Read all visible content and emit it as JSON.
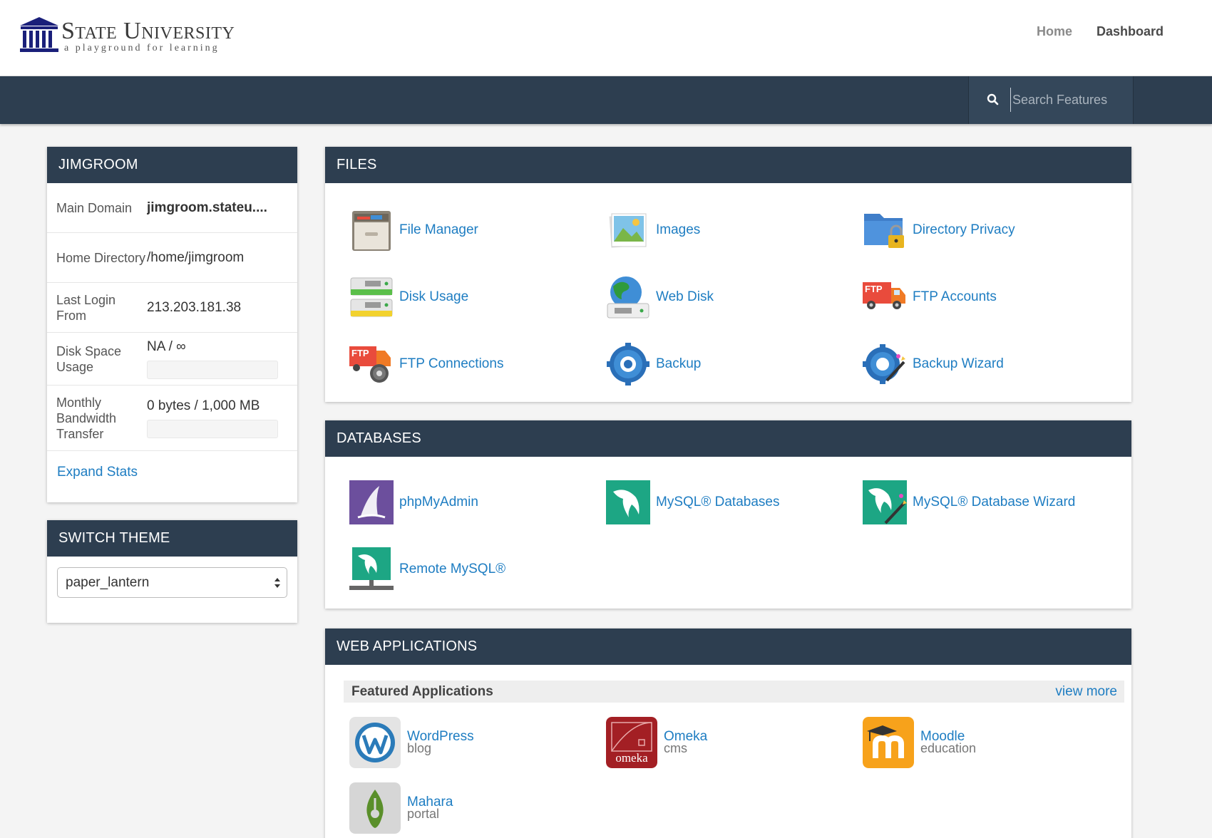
{
  "brand": {
    "title": "State University",
    "tagline": "a playground for learning"
  },
  "topnav": [
    {
      "label": "Home",
      "active": false
    },
    {
      "label": "Dashboard",
      "active": true
    }
  ],
  "search": {
    "placeholder": "Search Features",
    "icon": "search-icon"
  },
  "account": {
    "title": "JIMGROOM",
    "rows": [
      {
        "label": "Main Domain",
        "value": "jimgroom.stateu...."
      },
      {
        "label": "Home Directory",
        "value": "/home/jimgroom"
      },
      {
        "label": "Last Login From",
        "value": "213.203.181.38"
      },
      {
        "label": "Disk Space Usage",
        "value": "NA / ∞",
        "meter": 0
      },
      {
        "label": "Monthly Bandwidth Transfer",
        "value": "0 bytes / 1,000 MB",
        "meter": 0
      }
    ],
    "expand_label": "Expand Stats"
  },
  "theme": {
    "title": "SWITCH THEME",
    "selected": "paper_lantern"
  },
  "files": {
    "title": "FILES",
    "items": [
      {
        "label": "File Manager",
        "icon": "file-manager-icon"
      },
      {
        "label": "Images",
        "icon": "images-icon"
      },
      {
        "label": "Directory Privacy",
        "icon": "directory-privacy-icon"
      },
      {
        "label": "Disk Usage",
        "icon": "disk-usage-icon"
      },
      {
        "label": "Web Disk",
        "icon": "web-disk-icon"
      },
      {
        "label": "FTP Accounts",
        "icon": "ftp-accounts-icon"
      },
      {
        "label": "FTP Connections",
        "icon": "ftp-connections-icon"
      },
      {
        "label": "Backup",
        "icon": "backup-icon"
      },
      {
        "label": "Backup Wizard",
        "icon": "backup-wizard-icon"
      }
    ],
    "ftp_badge": "FTP"
  },
  "databases": {
    "title": "DATABASES",
    "items": [
      {
        "label": "phpMyAdmin",
        "icon": "phpmyadmin-icon"
      },
      {
        "label": "MySQL® Databases",
        "icon": "mysql-databases-icon"
      },
      {
        "label": "MySQL® Database Wizard",
        "icon": "mysql-wizard-icon"
      },
      {
        "label": "Remote MySQL®",
        "icon": "remote-mysql-icon"
      }
    ]
  },
  "webapps": {
    "title": "WEB APPLICATIONS",
    "featured_label": "Featured Applications",
    "view_more": "view more",
    "apps": [
      {
        "name": "WordPress",
        "category": "blog",
        "icon": "wordpress-icon"
      },
      {
        "name": "Omeka",
        "category": "cms",
        "icon": "omeka-icon",
        "badge": "omeka"
      },
      {
        "name": "Moodle",
        "category": "education",
        "icon": "moodle-icon"
      },
      {
        "name": "Mahara",
        "category": "portal",
        "icon": "mahara-icon"
      }
    ]
  },
  "colors": {
    "navy": "#2d3e50",
    "link": "#1e7dc2",
    "background": "#f4f4f4"
  }
}
